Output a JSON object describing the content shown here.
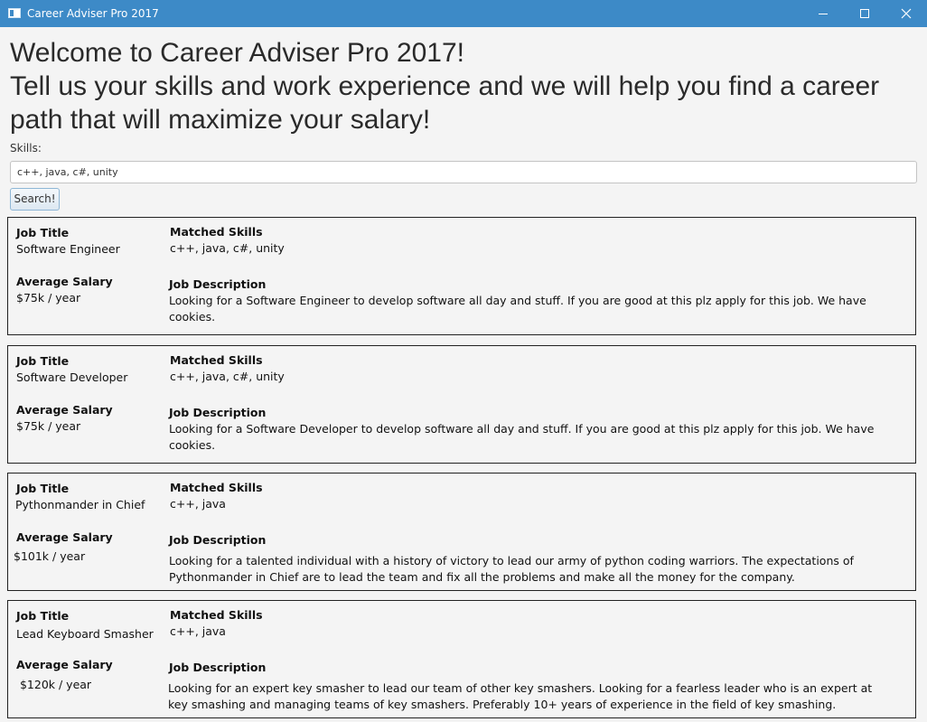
{
  "window": {
    "title": "Career Adviser Pro 2017",
    "accent_color": "#3d8ac7",
    "controls": [
      "minimize-icon",
      "maximize-icon",
      "close-icon"
    ]
  },
  "header": {
    "line1": "Welcome to Career Adviser Pro 2017!",
    "line2": "Tell us your skills and work experience and we will help you find a career path that will maximize your salary!"
  },
  "search": {
    "label": "Skills:",
    "value": "c++, java, c#, unity",
    "button_label": "Search!"
  },
  "labels": {
    "job_title": "Job Title",
    "average_salary": "Average Salary",
    "matched_skills": "Matched Skills",
    "job_description": "Job Description"
  },
  "results": [
    {
      "title": "Software Engineer",
      "salary": "$75k / year",
      "skills": "c++, java, c#, unity",
      "description": "Looking for a Software Engineer to develop software all day and stuff. If you are good at this plz apply for this job. We have cookies."
    },
    {
      "title": "Software Developer",
      "salary": "$75k / year",
      "skills": "c++, java, c#, unity",
      "description": "Looking for a Software  Developer to develop software all day and stuff. If you are good at this plz apply for this job. We have cookies."
    },
    {
      "title": "Pythonmander in Chief",
      "salary": "$101k / year",
      "skills": "c++, java",
      "description": "Looking for a talented individual with a history of victory to lead our army of python coding warriors. The expectations of Pythonmander in Chief are to lead the team and fix all the problems and make all the money for the company."
    },
    {
      "title": "Lead Keyboard Smasher",
      "salary": " $120k / year",
      "skills": "c++, java",
      "description": "Looking for an expert key smasher to lead our team of other key smashers. Looking for a fearless leader who is an expert at key smashing and managing teams of key smashers. Preferably 10+ years of experience in the field of key smashing."
    }
  ]
}
